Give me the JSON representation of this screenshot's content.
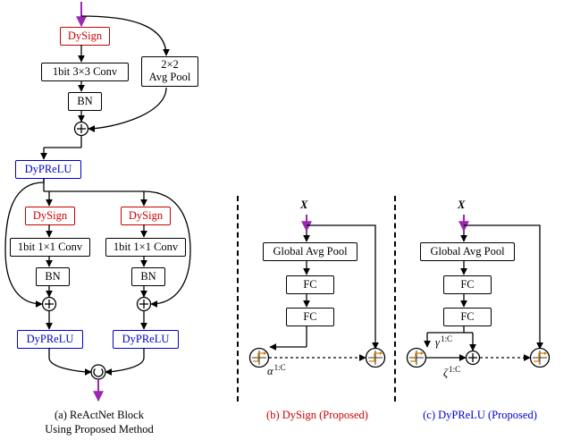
{
  "colA": {
    "dysign_top": "DySign",
    "conv3": "1bit 3×3 Conv",
    "avgpool": "2×2\nAvg Pool",
    "bn1": "BN",
    "dyprelu_top": "DyPReLU",
    "dysign_l": "DySign",
    "dysign_r": "DySign",
    "conv1_l": "1bit 1×1 Conv",
    "conv1_r": "1bit 1×1 Conv",
    "bn_l": "BN",
    "bn_r": "BN",
    "dyprelu_l": "DyPReLU",
    "dyprelu_r": "DyPReLU",
    "caption1": "(a) ReActNet Block",
    "caption2": "Using Proposed Method"
  },
  "colB": {
    "X": "X",
    "gap": "Global Avg Pool",
    "fc1": "FC",
    "fc2": "FC",
    "alpha": "α",
    "alpha_sup": "1:C",
    "caption": "(b) DySign (Proposed)"
  },
  "colC": {
    "X": "X",
    "gap": "Global Avg Pool",
    "fc1": "FC",
    "fc2": "FC",
    "gamma": "γ",
    "gamma_sup": "1:C",
    "zeta": "ζ",
    "zeta_sup": "1:C",
    "caption": "(c) DyPReLU (Proposed)"
  },
  "chart_data": {
    "type": "diagram",
    "subfigures": [
      {
        "id": "a",
        "label": "(a) ReActNet Block Using Proposed Method",
        "nodes": [
          {
            "id": "in",
            "type": "input"
          },
          {
            "id": "dysign0",
            "type": "DySign",
            "style": "red"
          },
          {
            "id": "conv3",
            "type": "1bit 3x3 Conv"
          },
          {
            "id": "pool",
            "type": "2x2 Avg Pool"
          },
          {
            "id": "bn0",
            "type": "BN"
          },
          {
            "id": "add0",
            "type": "add"
          },
          {
            "id": "dyprelu0",
            "type": "DyPReLU",
            "style": "blue"
          },
          {
            "id": "dysignL",
            "type": "DySign",
            "style": "red"
          },
          {
            "id": "dysignR",
            "type": "DySign",
            "style": "red"
          },
          {
            "id": "conv1L",
            "type": "1bit 1x1 Conv"
          },
          {
            "id": "conv1R",
            "type": "1bit 1x1 Conv"
          },
          {
            "id": "bnL",
            "type": "BN"
          },
          {
            "id": "bnR",
            "type": "BN"
          },
          {
            "id": "addL",
            "type": "add"
          },
          {
            "id": "addR",
            "type": "add"
          },
          {
            "id": "dypreluL",
            "type": "DyPReLU",
            "style": "blue"
          },
          {
            "id": "dypreluR",
            "type": "DyPReLU",
            "style": "blue"
          },
          {
            "id": "concat",
            "type": "concat"
          },
          {
            "id": "out",
            "type": "output"
          }
        ],
        "edges": [
          [
            "in",
            "dysign0"
          ],
          [
            "dysign0",
            "conv3"
          ],
          [
            "conv3",
            "bn0"
          ],
          [
            "bn0",
            "add0"
          ],
          [
            "in",
            "pool",
            "skip-right"
          ],
          [
            "pool",
            "add0",
            "skip-right"
          ],
          [
            "add0",
            "dyprelu0"
          ],
          [
            "dyprelu0",
            "dysignL"
          ],
          [
            "dyprelu0",
            "dysignR"
          ],
          [
            "dysignL",
            "conv1L"
          ],
          [
            "conv1L",
            "bnL"
          ],
          [
            "bnL",
            "addL"
          ],
          [
            "dyprelu0",
            "addL",
            "skip-left"
          ],
          [
            "dysignR",
            "conv1R"
          ],
          [
            "conv1R",
            "bnR"
          ],
          [
            "bnR",
            "addR"
          ],
          [
            "dyprelu0",
            "addR",
            "skip-right"
          ],
          [
            "addL",
            "dypreluL"
          ],
          [
            "addR",
            "dypreluR"
          ],
          [
            "dypreluL",
            "concat"
          ],
          [
            "dypreluR",
            "concat"
          ],
          [
            "concat",
            "out"
          ]
        ]
      },
      {
        "id": "b",
        "label": "(b) DySign (Proposed)",
        "style": "red",
        "nodes": [
          {
            "id": "X",
            "type": "input",
            "label": "X"
          },
          {
            "id": "gap",
            "type": "Global Avg Pool"
          },
          {
            "id": "fc1",
            "type": "FC"
          },
          {
            "id": "fc2",
            "type": "FC",
            "output": "alpha^{1:C}"
          },
          {
            "id": "sign0",
            "type": "activation-shift-sign"
          },
          {
            "id": "sign1",
            "type": "activation-shift-sign"
          }
        ],
        "edges": [
          [
            "X",
            "gap"
          ],
          [
            "gap",
            "fc1"
          ],
          [
            "fc1",
            "fc2"
          ],
          [
            "fc2",
            "sign0",
            "param alpha"
          ],
          [
            "X",
            "sign1",
            "skip"
          ],
          [
            "sign0",
            "sign1",
            "dotted"
          ]
        ]
      },
      {
        "id": "c",
        "label": "(c) DyPReLU (Proposed)",
        "style": "blue",
        "nodes": [
          {
            "id": "X",
            "type": "input",
            "label": "X"
          },
          {
            "id": "gap",
            "type": "Global Avg Pool"
          },
          {
            "id": "fc1",
            "type": "FC"
          },
          {
            "id": "fc2",
            "type": "FC",
            "output": [
              "gamma^{1:C}",
              "zeta^{1:C}"
            ]
          },
          {
            "id": "prelu0",
            "type": "activation-shift-prelu"
          },
          {
            "id": "add",
            "type": "add"
          },
          {
            "id": "prelu1",
            "type": "activation-shift-prelu"
          }
        ],
        "edges": [
          [
            "X",
            "gap"
          ],
          [
            "gap",
            "fc1"
          ],
          [
            "fc1",
            "fc2"
          ],
          [
            "fc2",
            "prelu0",
            "param gamma"
          ],
          [
            "prelu0",
            "add"
          ],
          [
            "fc2",
            "add",
            "param zeta"
          ],
          [
            "X",
            "prelu1",
            "skip"
          ],
          [
            "add",
            "prelu1",
            "dotted"
          ]
        ]
      }
    ]
  }
}
